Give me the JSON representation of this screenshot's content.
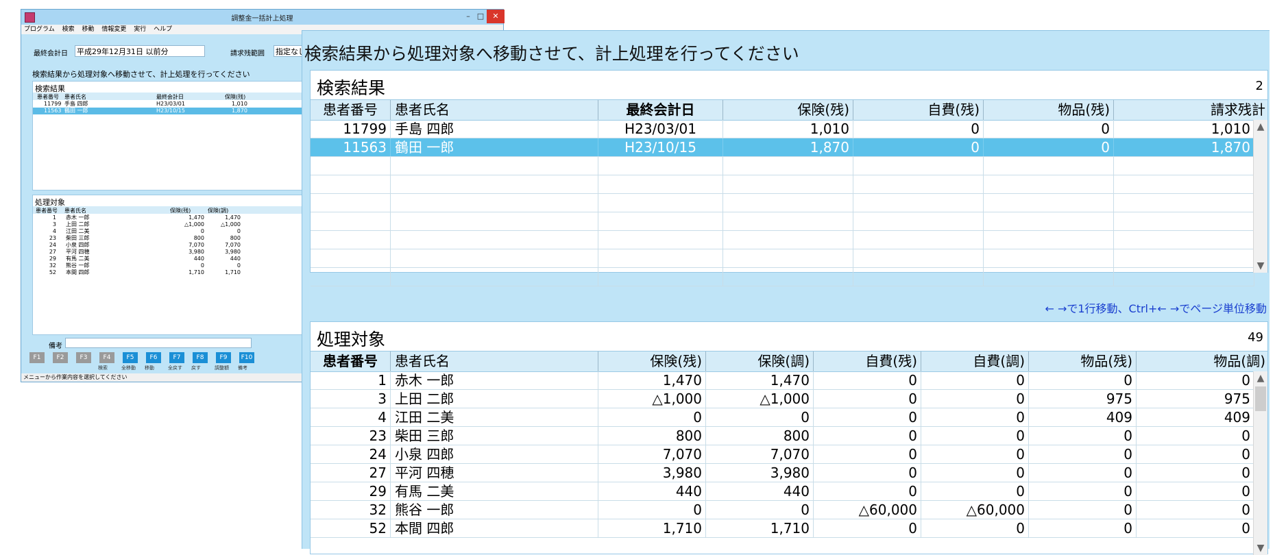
{
  "small_window": {
    "title": "調整金一括計上処理",
    "menu": [
      "プログラム",
      "検索",
      "移動",
      "情報変更",
      "実行",
      "ヘルプ"
    ],
    "last_settlement_label": "最終会計日",
    "last_settlement_value": "平成29年12月31日 以前分",
    "billing_range_label": "請求残範囲",
    "billing_range_value": "指定なし",
    "instruction": "検索結果から処理対象へ移動させて、計上処理を行ってください",
    "search_title": "検索結果",
    "search_headers": [
      "患者番号",
      "患者氏名",
      "最終会計日",
      "保険(残)"
    ],
    "search_rows": [
      [
        "11799",
        "手島 四郎",
        "H23/03/01",
        "1,010"
      ],
      [
        "11563",
        "鶴田 一郎",
        "H23/10/15",
        "1,870"
      ]
    ],
    "target_title": "処理対象",
    "target_headers": [
      "患者番号",
      "患者氏名",
      "保険(残)",
      "保険(調)"
    ],
    "target_rows": [
      [
        "1",
        "赤木 一郎",
        "1,470",
        "1,470"
      ],
      [
        "3",
        "上田 二郎",
        "△1,000",
        "△1,000"
      ],
      [
        "4",
        "江田 二美",
        "0",
        "0"
      ],
      [
        "23",
        "柴田 三郎",
        "800",
        "800"
      ],
      [
        "24",
        "小泉 四郎",
        "7,070",
        "7,070"
      ],
      [
        "27",
        "平河 四穂",
        "3,980",
        "3,980"
      ],
      [
        "29",
        "有馬 二美",
        "440",
        "440"
      ],
      [
        "32",
        "熊谷 一郎",
        "0",
        "0"
      ],
      [
        "52",
        "本間 四郎",
        "1,710",
        "1,710"
      ]
    ],
    "memo_label": "備考",
    "fkeys": [
      {
        "key": "F1",
        "sub": "",
        "on": false
      },
      {
        "key": "F2",
        "sub": "",
        "on": false
      },
      {
        "key": "F3",
        "sub": "",
        "on": false
      },
      {
        "key": "F4",
        "sub": "検索",
        "on": false
      },
      {
        "key": "F5",
        "sub": "全移動",
        "on": true
      },
      {
        "key": "F6",
        "sub": "移動",
        "on": true
      },
      {
        "key": "F7",
        "sub": "全戻す",
        "on": true
      },
      {
        "key": "F8",
        "sub": "戻す",
        "on": true
      },
      {
        "key": "F9",
        "sub": "調整額",
        "on": true
      },
      {
        "key": "F10",
        "sub": "備考",
        "on": true
      }
    ],
    "status": "メニューから作業内容を選択してください"
  },
  "big": {
    "instruction": "検索結果から処理対象へ移動させて、計上処理を行ってください",
    "search": {
      "title": "検索結果",
      "count": "2",
      "headers": [
        "患者番号",
        "患者氏名",
        "最終会計日",
        "保険(残)",
        "自費(残)",
        "物品(残)",
        "請求残計"
      ],
      "rows": [
        [
          "11799",
          "手島 四郎",
          "H23/03/01",
          "1,010",
          "0",
          "0",
          "1,010"
        ],
        [
          "11563",
          "鶴田 一郎",
          "H23/10/15",
          "1,870",
          "0",
          "0",
          "1,870"
        ]
      ],
      "selected_row": 1,
      "hint": "← →で1行移動、Ctrl+← →でページ単位移動"
    },
    "target": {
      "title": "処理対象",
      "count": "49",
      "headers": [
        "患者番号",
        "患者氏名",
        "保険(残)",
        "保険(調)",
        "自費(残)",
        "自費(調)",
        "物品(残)",
        "物品(調)"
      ],
      "rows": [
        [
          "1",
          "赤木 一郎",
          "1,470",
          "1,470",
          "0",
          "0",
          "0",
          "0"
        ],
        [
          "3",
          "上田 二郎",
          "△1,000",
          "△1,000",
          "0",
          "0",
          "975",
          "975"
        ],
        [
          "4",
          "江田 二美",
          "0",
          "0",
          "0",
          "0",
          "409",
          "409"
        ],
        [
          "23",
          "柴田 三郎",
          "800",
          "800",
          "0",
          "0",
          "0",
          "0"
        ],
        [
          "24",
          "小泉 四郎",
          "7,070",
          "7,070",
          "0",
          "0",
          "0",
          "0"
        ],
        [
          "27",
          "平河 四穂",
          "3,980",
          "3,980",
          "0",
          "0",
          "0",
          "0"
        ],
        [
          "29",
          "有馬 二美",
          "440",
          "440",
          "0",
          "0",
          "0",
          "0"
        ],
        [
          "32",
          "熊谷 一郎",
          "0",
          "0",
          "△60,000",
          "△60,000",
          "0",
          "0"
        ],
        [
          "52",
          "本間 四郎",
          "1,710",
          "1,710",
          "0",
          "0",
          "0",
          "0"
        ]
      ]
    }
  },
  "icons": {
    "scroll_up": "▲",
    "scroll_down": "▼",
    "minimize": "–",
    "maximize": "□",
    "close": "✕"
  }
}
